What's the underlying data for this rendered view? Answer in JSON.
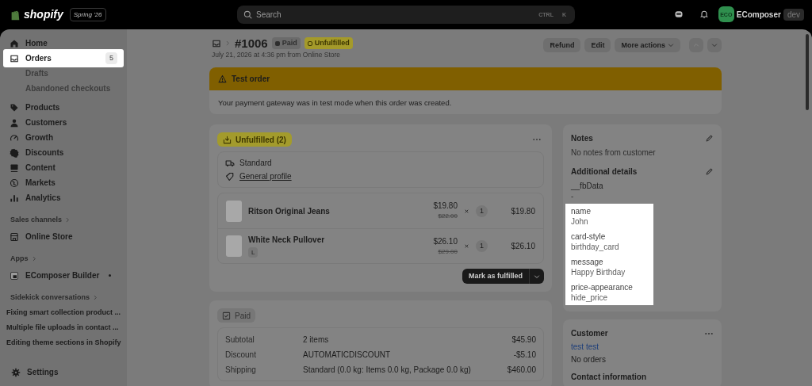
{
  "topbar": {
    "brand": "shopify",
    "edition": "Spring '26",
    "search": {
      "placeholder": "Search",
      "keys": [
        "CTRL",
        "K"
      ]
    },
    "account": {
      "avatar": "ECO",
      "name": "EComposer",
      "badge": "dev"
    }
  },
  "sidebar": {
    "items": [
      {
        "label": "Home",
        "highlighted": false
      },
      {
        "label": "Orders",
        "badge": "5",
        "highlighted": true,
        "children": [
          {
            "label": "Drafts"
          },
          {
            "label": "Abandoned checkouts"
          }
        ]
      },
      {
        "label": "Products",
        "highlighted": false
      },
      {
        "label": "Customers",
        "highlighted": false
      },
      {
        "label": "Growth",
        "highlighted": false
      },
      {
        "label": "Discounts",
        "highlighted": false
      },
      {
        "label": "Content",
        "highlighted": false
      },
      {
        "label": "Markets",
        "highlighted": false
      },
      {
        "label": "Analytics",
        "highlighted": false
      }
    ],
    "sections": [
      {
        "title": "Sales channels",
        "items": [
          {
            "label": "Online Store",
            "kind": "app"
          }
        ]
      },
      {
        "title": "Apps",
        "items": [
          {
            "label": "EComposer Builder",
            "kind": "app",
            "pinned": true
          }
        ]
      },
      {
        "title": "Sidekick conversations",
        "items": [
          {
            "label": "Fixing smart collection product ...",
            "kind": "conversation"
          },
          {
            "label": "Multiple file uploads in contact ...",
            "kind": "conversation"
          },
          {
            "label": "Editing theme sections in Shopify",
            "kind": "conversation"
          }
        ]
      }
    ],
    "settings": "Settings"
  },
  "order": {
    "number": "#1006",
    "badges": [
      {
        "label": "Paid",
        "kind": "paid"
      },
      {
        "label": "Unfulfilled",
        "kind": "unfulfilled"
      }
    ],
    "date": "July 21, 2026 at 4:36 pm from Online Store",
    "actions": [
      "Refund",
      "Edit",
      "More actions"
    ],
    "nav": [
      {
        "disabled": true
      },
      {
        "disabled": false
      }
    ]
  },
  "banner": {
    "title": "Test order",
    "text": "Your payment gateway was in test mode when this order was created."
  },
  "fulfillment": {
    "badge": "Unfulfilled (2)",
    "delivery": "Standard",
    "profile": "General profile",
    "items": [
      {
        "name": "Ritson Original Jeans",
        "price": "$19.80",
        "original_price": "$22.00",
        "quantity": "1",
        "total": "$19.80"
      },
      {
        "name": "White Neck Pullover",
        "variant": "L",
        "price": "$26.10",
        "original_price": "$29.00",
        "quantity": "1",
        "total": "$26.10"
      }
    ],
    "button": "Mark as fulfilled"
  },
  "payment": {
    "badge": "Paid",
    "rows": [
      {
        "label": "Subtotal",
        "detail": "2 items",
        "amount": "$45.90"
      },
      {
        "label": "Discount",
        "detail": "AUTOMATICDISCOUNT",
        "amount": "-$5.10"
      },
      {
        "label": "Shipping",
        "detail": "Standard (0.0 kg: Items 0.0 kg, Package 0.0 kg)",
        "amount": "$460.00"
      }
    ]
  },
  "notes": {
    "title": "Notes",
    "text": "No notes from customer",
    "details_title": "Additional details",
    "details": [
      {
        "key": "__fbData",
        "value": "-",
        "highlighted": false
      },
      {
        "key": "name",
        "value": "John",
        "highlighted": true
      },
      {
        "key": "card-style",
        "value": "birthday_card",
        "highlighted": true
      },
      {
        "key": "message",
        "value": "Happy Birthday",
        "highlighted": true
      },
      {
        "key": "price-appearance",
        "value": "hide_price",
        "highlighted": true
      }
    ]
  },
  "customer": {
    "title": "Customer",
    "name": "test test",
    "orders": "No orders",
    "contact_title": "Contact information"
  }
}
